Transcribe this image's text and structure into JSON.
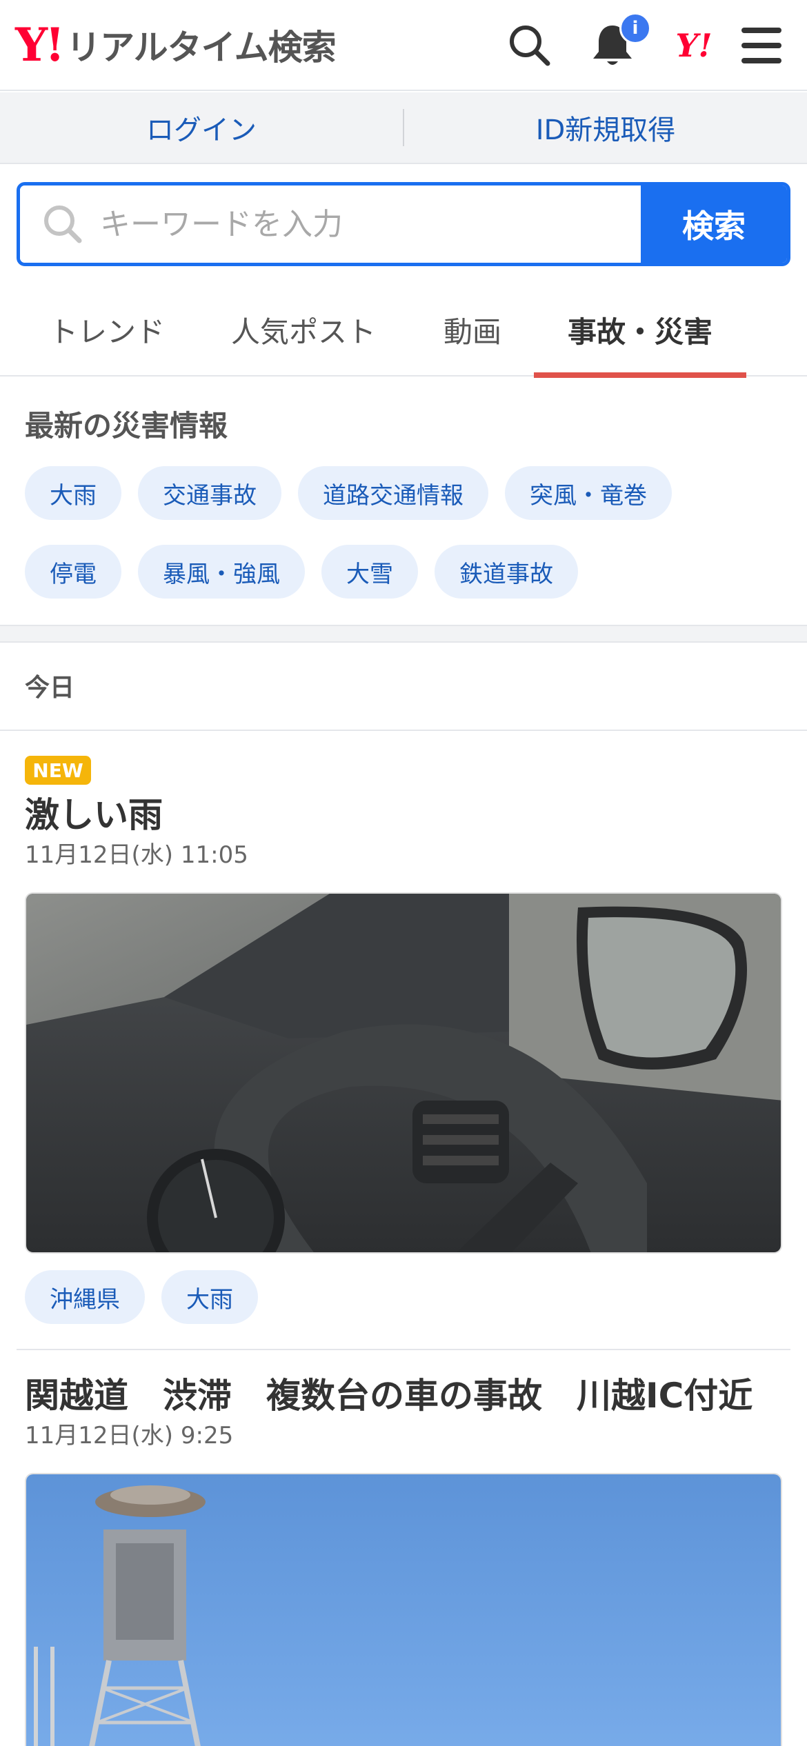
{
  "header": {
    "logo_mark": "Y!",
    "logo_text": "リアルタイム検索",
    "notification_badge": "i",
    "yahoo_mark": "Y!",
    "icons": [
      "search-icon",
      "bell-icon",
      "yahoo-logo-icon",
      "menu-icon"
    ]
  },
  "login_bar": {
    "login": "ログイン",
    "signup": "ID新規取得"
  },
  "search": {
    "placeholder": "キーワードを入力",
    "button": "検索"
  },
  "tabs": [
    {
      "label": "トレンド",
      "active": false
    },
    {
      "label": "人気ポスト",
      "active": false
    },
    {
      "label": "動画",
      "active": false
    },
    {
      "label": "事故・災害",
      "active": true
    }
  ],
  "disaster_info": {
    "title": "最新の災害情報",
    "chips_row1": [
      "大雨",
      "交通事故",
      "道路交通情報",
      "突風・竜巻"
    ],
    "chips_row2": [
      "停電",
      "暴風・強風",
      "大雪",
      "鉄道事故"
    ]
  },
  "day_label": "今日",
  "articles": [
    {
      "badge": "NEW",
      "title": "激しい雨",
      "date": "11月12日(水) 11:05",
      "tags": [
        "沖縄県",
        "大雨"
      ]
    },
    {
      "title": "関越道　渋滞　複数台の車の事故　川越IC付近",
      "date": "11月12日(水) 9:25"
    }
  ],
  "colors": {
    "accent_blue": "#1a6ff0",
    "link_blue": "#1a5bb8",
    "brand_red": "#ff0033",
    "active_tab_underline": "#e0524a",
    "new_badge": "#f5b50a"
  }
}
